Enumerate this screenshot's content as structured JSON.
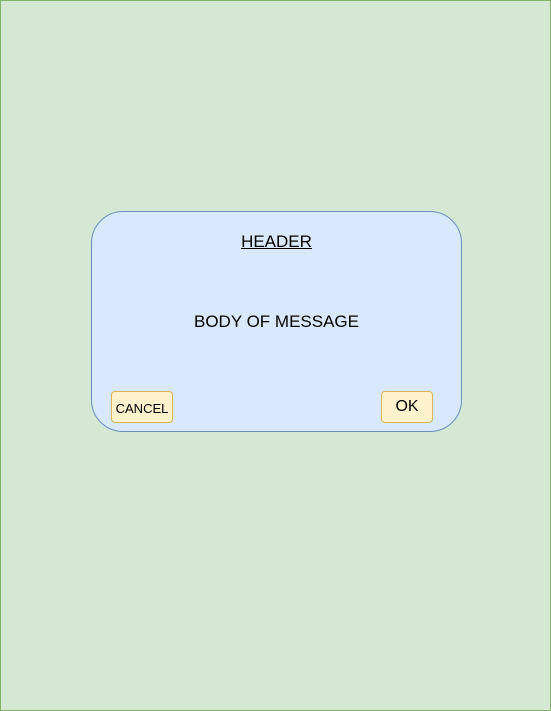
{
  "dialog": {
    "header": "HEADER",
    "body": "BODY OF MESSAGE",
    "buttons": {
      "cancel_label": "CANCEL",
      "ok_label": "OK"
    }
  },
  "colors": {
    "page_background": "#d5e8d4",
    "page_border": "#82b366",
    "dialog_background": "#dae8fc",
    "dialog_border": "#6c8ebf",
    "button_background": "#fff2cc",
    "button_border": "#d6b656"
  }
}
